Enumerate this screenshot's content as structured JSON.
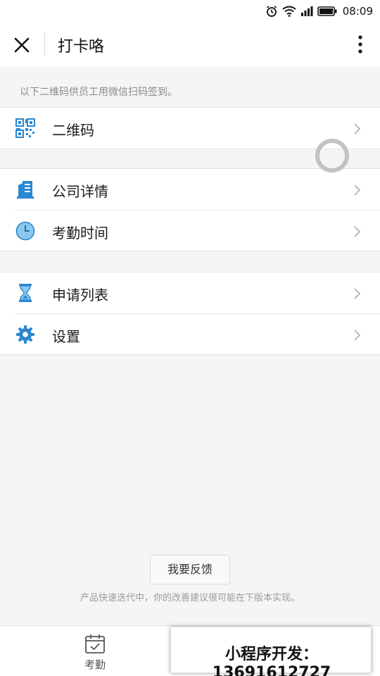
{
  "status_bar": {
    "time": "08:09"
  },
  "header": {
    "title": "打卡咯"
  },
  "tip": "以下二维码供员工用微信扫码签到。",
  "groups": [
    {
      "items": [
        {
          "label": "二维码",
          "icon": "qr-code-icon"
        }
      ]
    },
    {
      "items": [
        {
          "label": "公司详情",
          "icon": "building-icon"
        },
        {
          "label": "考勤时间",
          "icon": "clock-icon"
        }
      ]
    },
    {
      "items": [
        {
          "label": "申请列表",
          "icon": "hourglass-icon"
        },
        {
          "label": "设置",
          "icon": "gear-icon"
        }
      ]
    }
  ],
  "feedback": {
    "button_label": "我要反馈",
    "note": "产品快速迭代中，你的改善建议很可能在下版本实现。"
  },
  "tabbar": {
    "items": [
      {
        "label": "考勤",
        "icon": "calendar-check-icon"
      }
    ]
  },
  "promo": {
    "text": "小程序开发：13691612727"
  },
  "colors": {
    "icon_blue": "#2a88d0",
    "icon_light_blue": "#8cc8ee",
    "background": "#f5f5f5"
  }
}
